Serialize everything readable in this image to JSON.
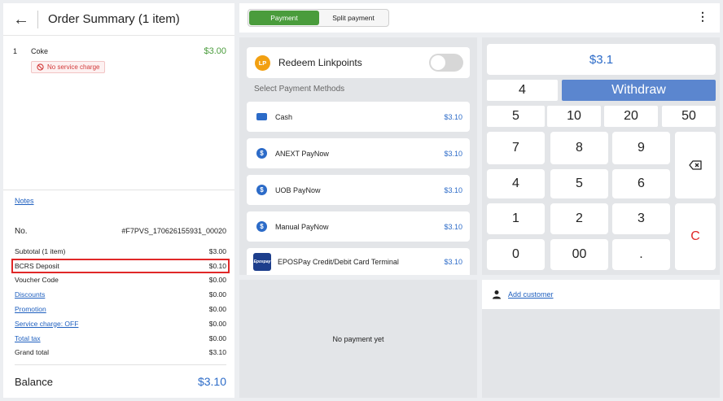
{
  "order": {
    "title": "Order Summary (1 item)",
    "items": [
      {
        "qty": "1",
        "name": "Coke",
        "price": "$3.00",
        "badge": "No service charge"
      }
    ]
  },
  "summary": {
    "notes_label": "Notes",
    "no_label": "No.",
    "no_value": "#F7PVS_170626155931_00020",
    "rows": [
      {
        "label": "Subtotal (1 item)",
        "value": "$3.00"
      },
      {
        "label": "BCRS Deposit",
        "value": "$0.10"
      },
      {
        "label": "Voucher Code",
        "value": "$0.00"
      },
      {
        "label": "Discounts",
        "value": "$0.00"
      },
      {
        "label": "Promotion",
        "value": "$0.00"
      },
      {
        "label": "Service charge: OFF",
        "value": "$0.00"
      },
      {
        "label": "Total tax",
        "value": "$0.00"
      },
      {
        "label": "Grand total",
        "value": "$3.10"
      }
    ],
    "balance_label": "Balance",
    "balance_value": "$3.10"
  },
  "topbar": {
    "tabs": [
      "Payment",
      "Split payment"
    ],
    "active_tab": "Payment"
  },
  "payment": {
    "redeem_badge": "LP",
    "redeem_label": "Redeem Linkpoints",
    "redeem_enabled": false,
    "select_label": "Select Payment Methods",
    "methods": [
      {
        "label": "Cash",
        "amount": "$3.10",
        "icon": "cash-icon"
      },
      {
        "label": "ANEXT PayNow",
        "amount": "$3.10",
        "icon": "dollar-coin-icon"
      },
      {
        "label": "UOB PayNow",
        "amount": "$3.10",
        "icon": "dollar-coin-icon"
      },
      {
        "label": "Manual PayNow",
        "amount": "$3.10",
        "icon": "dollar-coin-icon"
      },
      {
        "label": "EPOSPay Credit/Debit Card Terminal",
        "amount": "$3.10",
        "icon": "epos-logo-icon",
        "logo_text": "Epospay"
      }
    ]
  },
  "keypad": {
    "amount": "$3.1",
    "row1": [
      "4"
    ],
    "withdraw_label": "Withdraw",
    "row2": [
      "5",
      "10",
      "20",
      "50"
    ],
    "digits": [
      "7",
      "8",
      "9",
      "4",
      "5",
      "6",
      "1",
      "2",
      "3",
      "0",
      "00",
      "."
    ],
    "clear_label": "C",
    "backspace_icon": "backspace-icon"
  },
  "payments_list": {
    "empty_text": "No payment yet"
  },
  "customer": {
    "add_label": "Add customer"
  },
  "colors": {
    "accent_green": "#4a9c3c",
    "accent_blue": "#2c6bc8",
    "withdraw_bg": "#5b86cf",
    "highlight_red": "#e02828"
  }
}
